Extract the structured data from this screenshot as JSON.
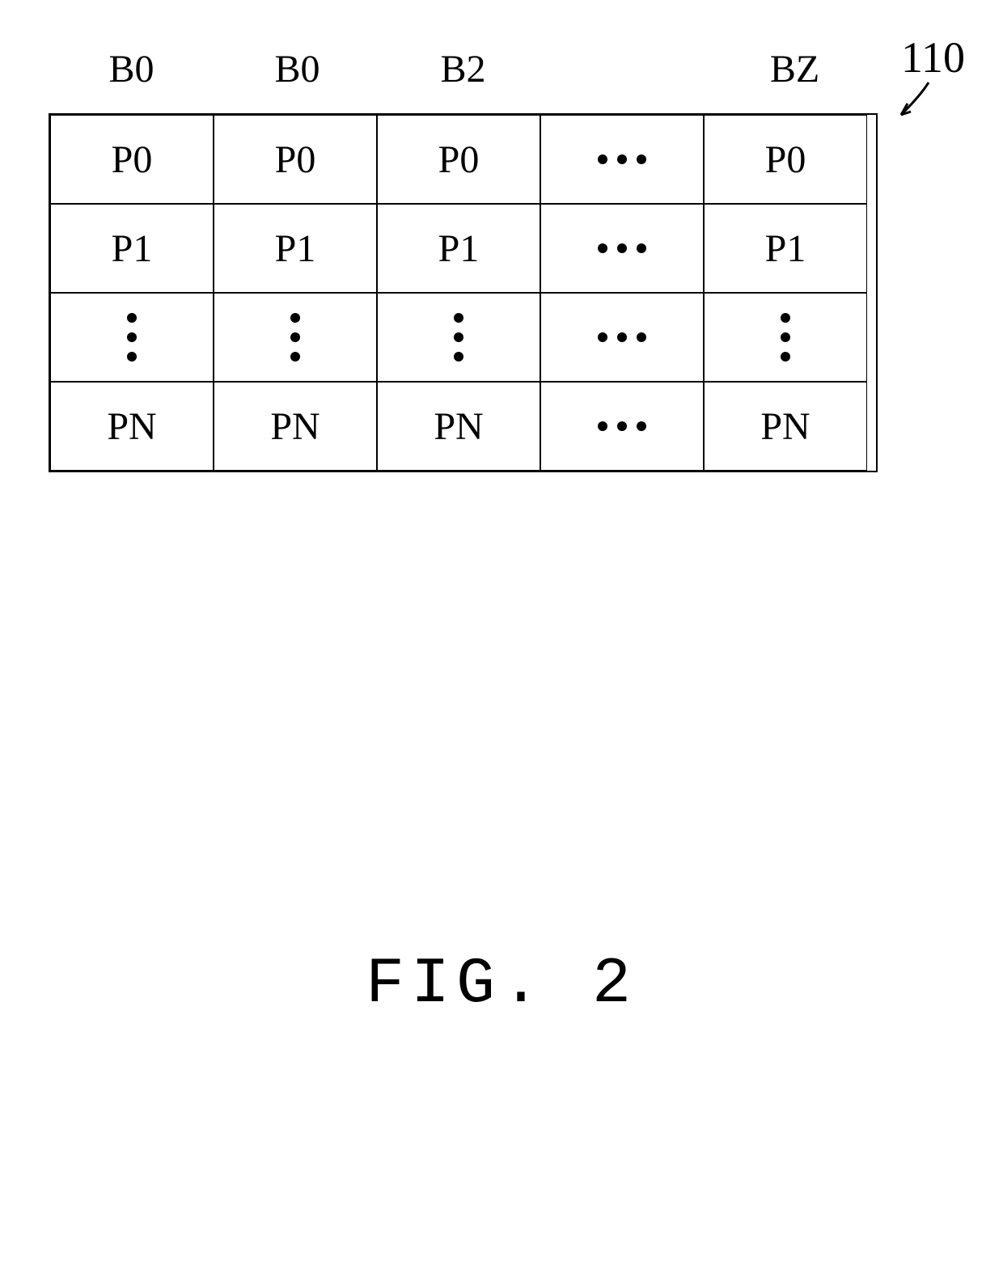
{
  "chart_data": {
    "type": "table",
    "ref": "110",
    "columns": [
      "B0",
      "B0",
      "B2",
      "…",
      "BZ"
    ],
    "rows": [
      [
        "P0",
        "P0",
        "P0",
        "…",
        "P0"
      ],
      [
        "P1",
        "P1",
        "P1",
        "…",
        "P1"
      ],
      [
        "⋮",
        "⋮",
        "⋮",
        "…",
        "⋮"
      ],
      [
        "PN",
        "PN",
        "PN",
        "…",
        "PN"
      ]
    ]
  },
  "columns": {
    "c0": "B0",
    "c1": "B0",
    "c2": "B2",
    "c4": "BZ"
  },
  "cells": {
    "r0c0": "P0",
    "r0c1": "P0",
    "r0c2": "P0",
    "r0c4": "P0",
    "r1c0": "P1",
    "r1c1": "P1",
    "r1c2": "P1",
    "r1c4": "P1",
    "r3c0": "PN",
    "r3c1": "PN",
    "r3c2": "PN",
    "r3c4": "PN"
  },
  "ref_label": "110",
  "caption": "FIG. 2"
}
